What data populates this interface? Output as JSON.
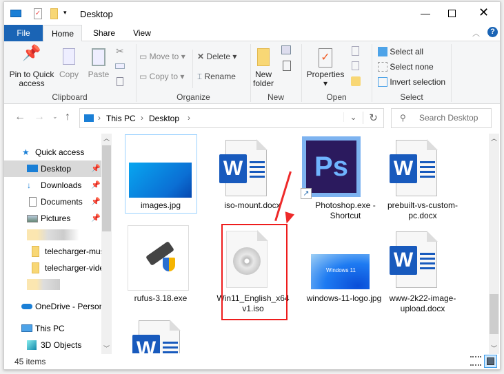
{
  "title": "Desktop",
  "window_controls": {
    "minimize": "minimize-icon",
    "maximize": "maximize-icon",
    "close": "close-icon"
  },
  "tabs": [
    {
      "label": "File"
    },
    {
      "label": "Home"
    },
    {
      "label": "Share"
    },
    {
      "label": "View"
    }
  ],
  "ribbon": {
    "clipboard": {
      "pin": "Pin to Quick access",
      "copy": "Copy",
      "paste": "Paste",
      "label": "Clipboard"
    },
    "organize": {
      "move_to": "Move to",
      "copy_to": "Copy to",
      "delete": "Delete",
      "rename": "Rename",
      "label": "Organize"
    },
    "new": {
      "new_folder": "New folder",
      "label": "New"
    },
    "open": {
      "properties": "Properties",
      "label": "Open"
    },
    "select": {
      "select_all": "Select all",
      "select_none": "Select none",
      "invert": "Invert selection",
      "label": "Select"
    }
  },
  "address": {
    "crumbs": [
      "This PC",
      "Desktop"
    ],
    "search_placeholder": "Search Desktop"
  },
  "nav": {
    "items": [
      {
        "label": "Quick access"
      },
      {
        "label": "Desktop"
      },
      {
        "label": "Downloads"
      },
      {
        "label": "Documents"
      },
      {
        "label": "Pictures"
      },
      {
        "label": "telecharger-mus"
      },
      {
        "label": "telecharger-vide"
      },
      {
        "label": "OneDrive - Person"
      },
      {
        "label": "This PC"
      },
      {
        "label": "3D Objects"
      }
    ]
  },
  "files": [
    {
      "name": "images.jpg"
    },
    {
      "name": "iso-mount.docx"
    },
    {
      "name": "Photoshop.exe - Shortcut"
    },
    {
      "name": "prebuilt-vs-custom-pc.docx"
    },
    {
      "name": "rufus-3.18.exe"
    },
    {
      "name": "Win11_English_x64v1.iso"
    },
    {
      "name": "windows-11-logo.jpg"
    },
    {
      "name": "www-2k22-image-upload.docx"
    }
  ],
  "thumb_text": {
    "ps": "Ps",
    "w": "W",
    "win11": "Windows 11"
  },
  "status": {
    "count": "45 items"
  },
  "colors": {
    "accent": "#1a64b5",
    "highlight": "#ee1c1c"
  }
}
